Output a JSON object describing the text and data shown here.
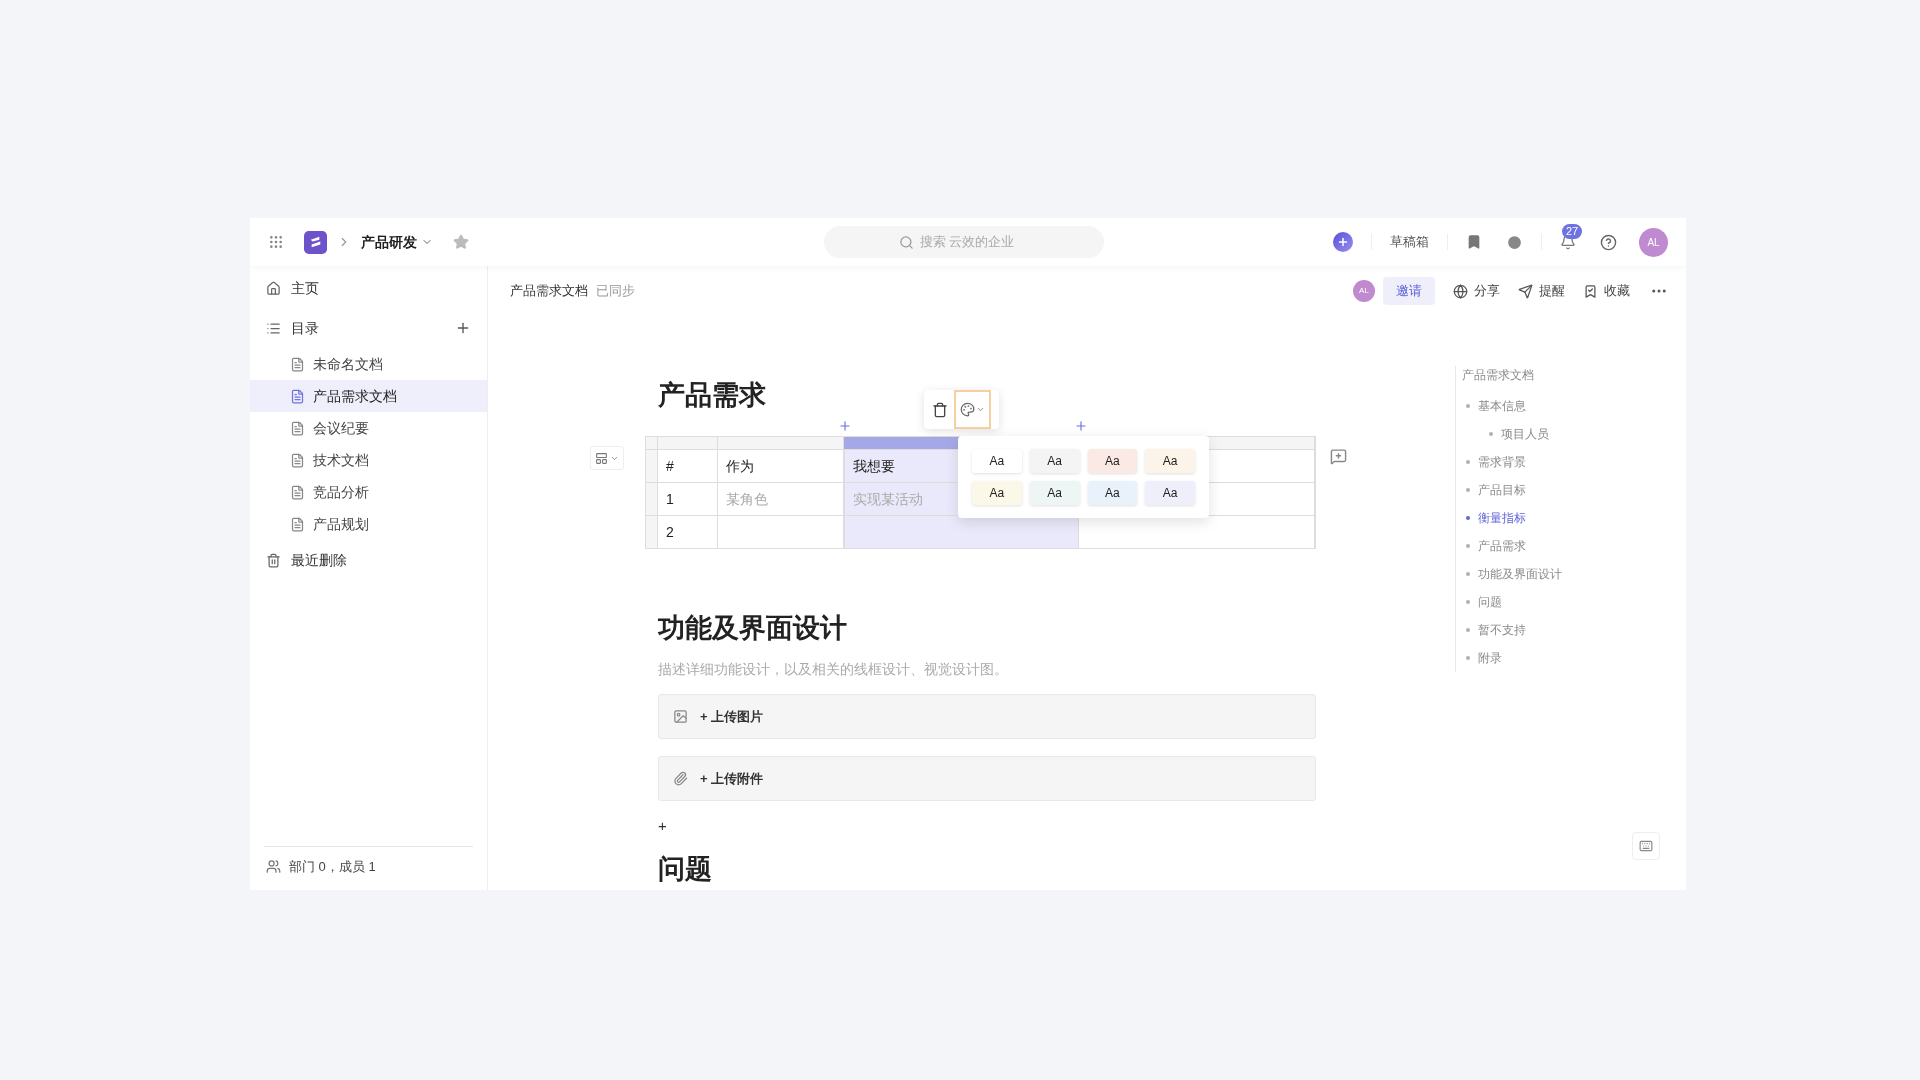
{
  "topbar": {
    "workspace": "产品研发",
    "search_placeholder": "搜索 云效的企业",
    "drafts": "草稿箱",
    "notification_count": "27",
    "avatar": "AL"
  },
  "sidebar": {
    "home": "主页",
    "catalog": "目录",
    "docs": [
      {
        "title": "未命名文档",
        "selected": false
      },
      {
        "title": "产品需求文档",
        "selected": true
      },
      {
        "title": "会议纪要",
        "selected": false
      },
      {
        "title": "技术文档",
        "selected": false
      },
      {
        "title": "竞品分析",
        "selected": false
      },
      {
        "title": "产品规划",
        "selected": false
      }
    ],
    "trash": "最近删除",
    "footer": "部门 0，成员 1"
  },
  "doc_header": {
    "title": "产品需求文档",
    "status": "已同步",
    "avatar": "AL",
    "invite": "邀请",
    "actions": [
      {
        "kind": "share",
        "label": "分享"
      },
      {
        "kind": "remind",
        "label": "提醒"
      },
      {
        "kind": "favorite",
        "label": "收藏"
      }
    ]
  },
  "content": {
    "heading": "产品需求",
    "table": {
      "columns": [
        {
          "label": "#",
          "selected": false
        },
        {
          "label": "作为",
          "selected": false
        },
        {
          "label": "我想要",
          "selected": true
        },
        {
          "selected": false
        }
      ],
      "rows": [
        {
          "number": "1",
          "cells": [
            {
              "placeholder": "某角色"
            },
            {
              "placeholder": "实现某活动"
            }
          ]
        },
        {
          "number": "2"
        }
      ]
    },
    "cell_color_menu": {
      "swatches": [
        {
          "label": "Aa",
          "color": "#ffffff"
        },
        {
          "label": "Aa",
          "color": "#f4f4f4"
        },
        {
          "label": "Aa",
          "color": "#fbe9e6"
        },
        {
          "label": "Aa",
          "color": "#fcf3e9"
        },
        {
          "label": "Aa",
          "color": "#fcf8e7"
        },
        {
          "label": "Aa",
          "color": "#eef5f5"
        },
        {
          "label": "Aa",
          "color": "#e9f2fb"
        },
        {
          "label": "Aa",
          "color": "#efeffb"
        }
      ]
    },
    "section": {
      "heading": "功能及界面设计",
      "description": "描述详细功能设计，以及相关的线框设计、视觉设计图。",
      "uploads": [
        {
          "kind": "image",
          "label": "+ 上传图片"
        },
        {
          "kind": "attachment",
          "label": "+ 上传附件"
        }
      ],
      "add": "+",
      "next_heading": "问题"
    }
  },
  "outline": {
    "title": "产品需求文档",
    "items": [
      {
        "label": "基本信息",
        "selected": false,
        "children": [
          {
            "label": "项目人员",
            "selected": false
          }
        ]
      },
      {
        "label": "需求背景",
        "selected": false
      },
      {
        "label": "产品目标",
        "selected": false
      },
      {
        "label": "衡量指标",
        "selected": true
      },
      {
        "label": "产品需求",
        "selected": false
      },
      {
        "label": "功能及界面设计",
        "selected": false
      },
      {
        "label": "问题",
        "selected": false
      },
      {
        "label": "暂不支持",
        "selected": false
      },
      {
        "label": "附录",
        "selected": false
      }
    ]
  }
}
